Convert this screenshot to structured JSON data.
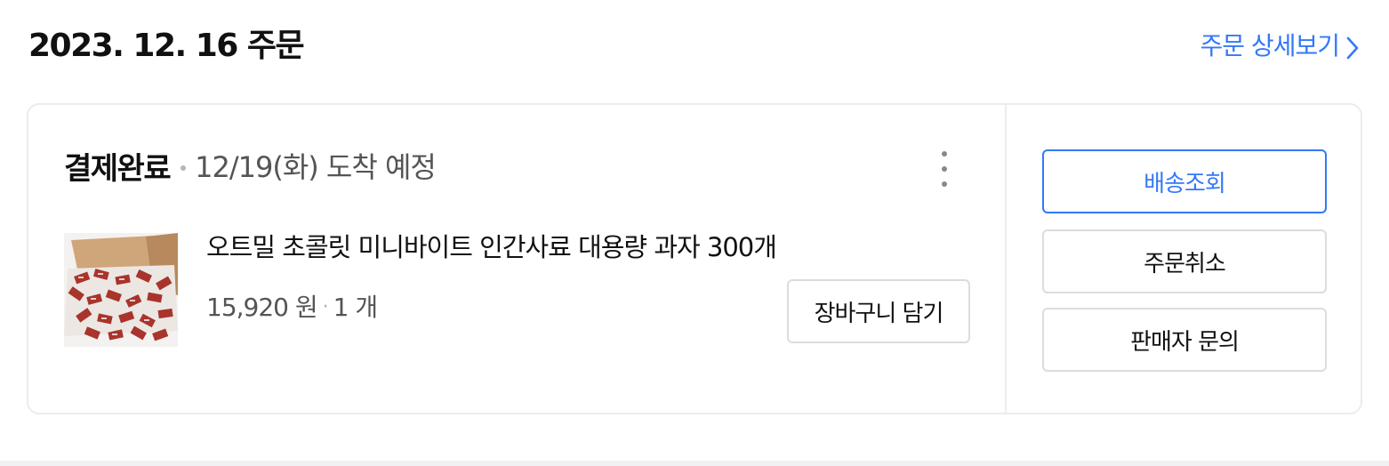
{
  "header": {
    "order_date_title": "2023. 12. 16 주문",
    "detail_link_label": "주문 상세보기"
  },
  "order": {
    "status": "결제완료",
    "arrival": "12/19(화) 도착 예정",
    "product": {
      "name": "오트밀 초콜릿 미니바이트 인간사료 대용량 과자 300개",
      "price": "15,920 원",
      "separator": "·",
      "quantity": "1 개"
    },
    "add_to_cart_label": "장바구니 담기"
  },
  "actions": {
    "track_delivery_label": "배송조회",
    "cancel_order_label": "주문취소",
    "seller_inquiry_label": "판매자 문의"
  },
  "icons": {
    "detail_link_icon": "chevron-right-icon",
    "more_icon": "vertical-ellipsis-icon",
    "status_separator_icon": "dot-icon"
  },
  "colors": {
    "accent": "#3478f6",
    "text_primary": "#111111",
    "text_secondary": "#555555",
    "border": "#dcdcdc"
  }
}
